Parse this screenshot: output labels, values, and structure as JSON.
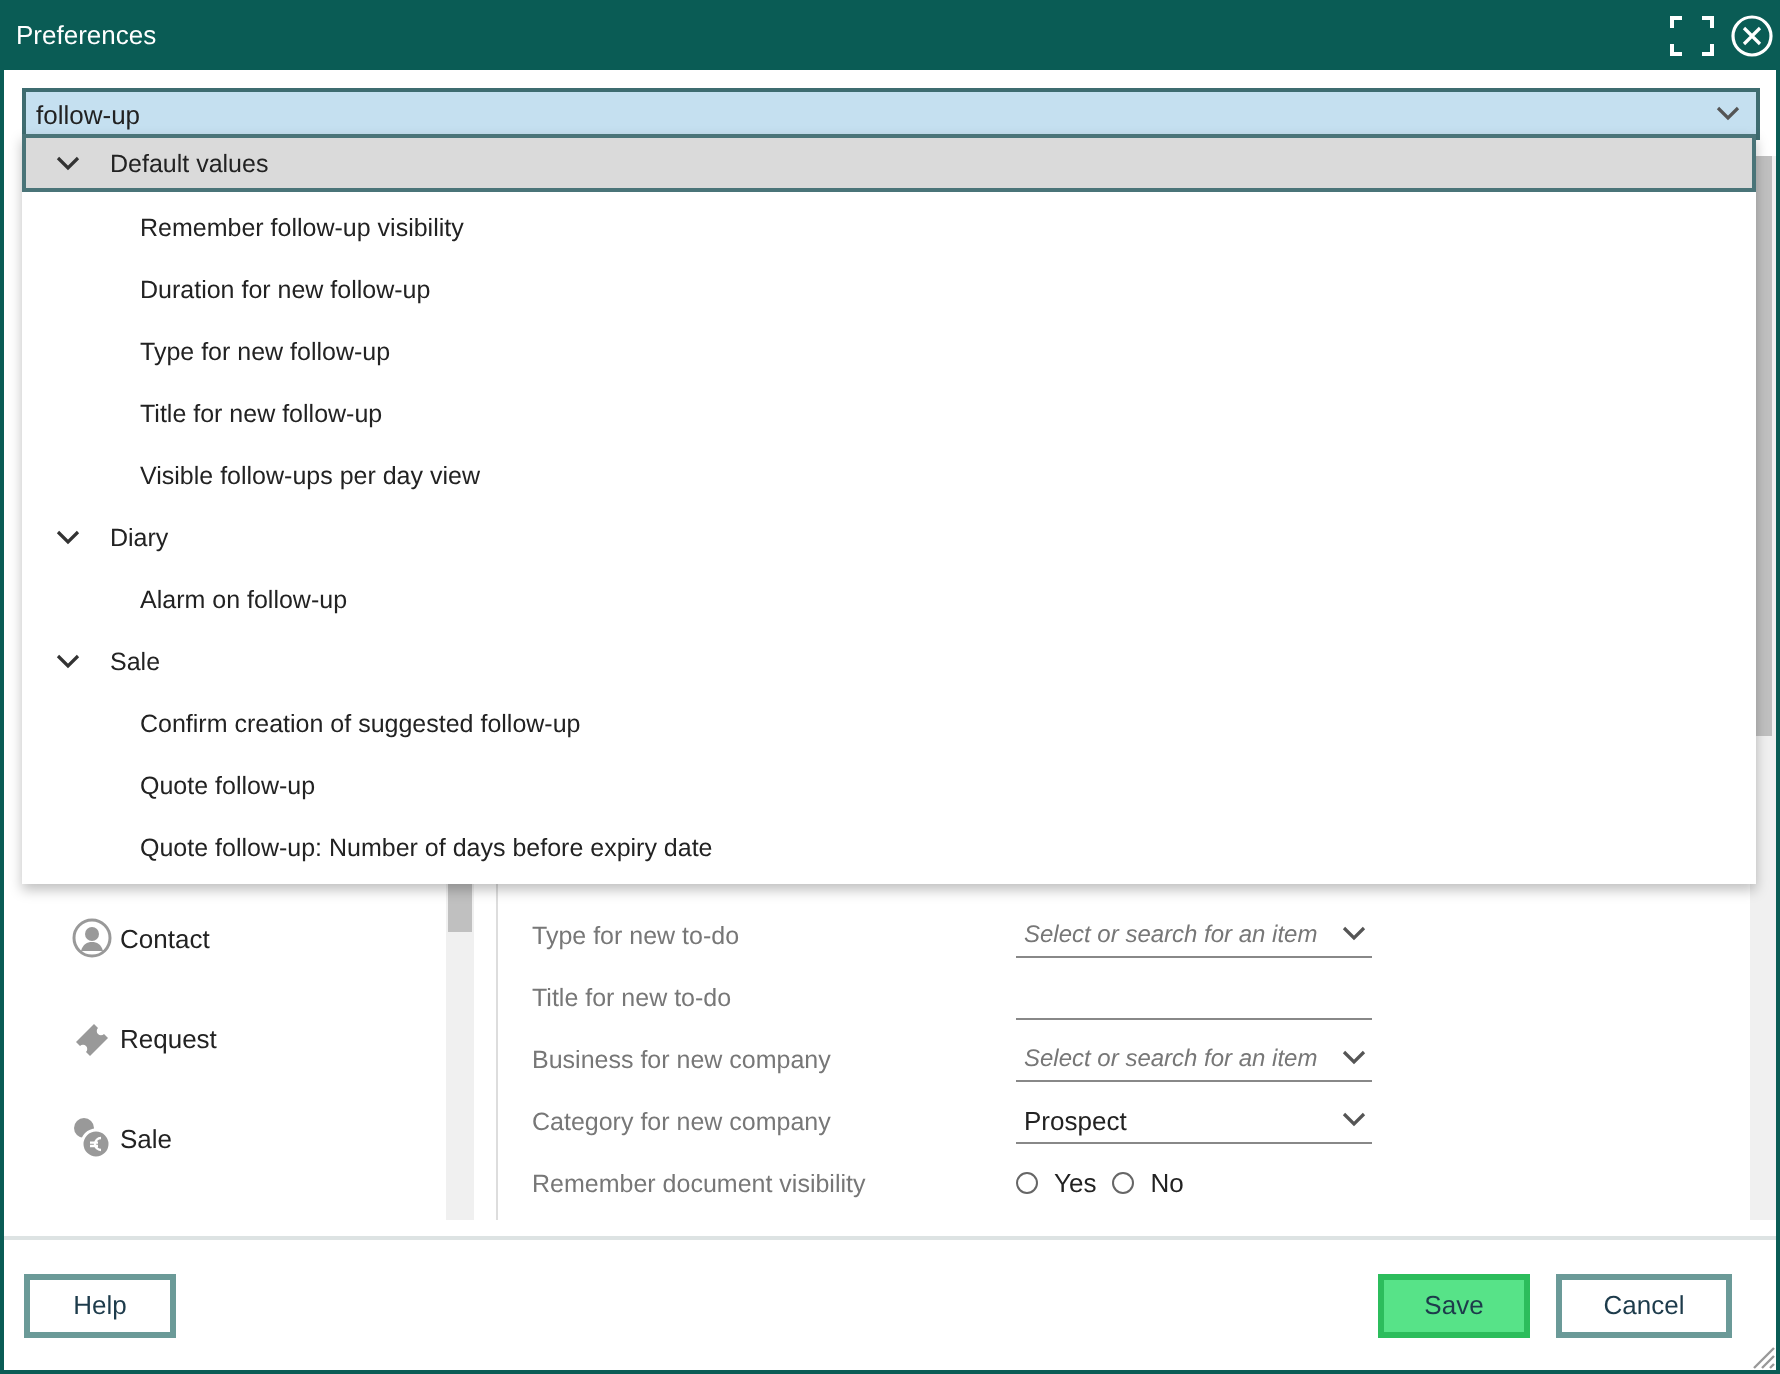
{
  "window": {
    "title": "Preferences"
  },
  "search": {
    "value": "follow-up"
  },
  "results": [
    {
      "label": "Default values",
      "expanded": true,
      "selected": true,
      "children": [
        {
          "label": "Remember follow-up visibility"
        },
        {
          "label": "Duration for new follow-up"
        },
        {
          "label": "Type for new follow-up"
        },
        {
          "label": "Title for new follow-up"
        },
        {
          "label": "Visible follow-ups per day view"
        }
      ]
    },
    {
      "label": "Diary",
      "expanded": true,
      "selected": false,
      "children": [
        {
          "label": "Alarm on follow-up"
        }
      ]
    },
    {
      "label": "Sale",
      "expanded": true,
      "selected": false,
      "children": [
        {
          "label": "Confirm creation of suggested follow-up"
        },
        {
          "label": "Quote follow-up"
        },
        {
          "label": "Quote follow-up: Number of days before expiry date"
        }
      ]
    }
  ],
  "sidebar": {
    "items": [
      {
        "label": "Contact",
        "kind": "contact"
      },
      {
        "label": "Request",
        "kind": "request"
      },
      {
        "label": "Sale",
        "kind": "sale"
      }
    ]
  },
  "settings": [
    {
      "label": "Type for new to-do",
      "kind": "select",
      "placeholder": "Select or search for an item"
    },
    {
      "label": "Title for new to-do",
      "kind": "text"
    },
    {
      "label": "Business for new company",
      "kind": "select",
      "placeholder": "Select or search for an item"
    },
    {
      "label": "Category for new company",
      "kind": "select",
      "value": "Prospect"
    },
    {
      "label": "Remember document visibility",
      "kind": "radio",
      "options": [
        {
          "label": "Yes",
          "selected": false
        },
        {
          "label": "No",
          "selected": false
        }
      ]
    }
  ],
  "buttons": [
    {
      "label": "Help",
      "kind": "plain"
    },
    {
      "label": "Save",
      "kind": "primary"
    },
    {
      "label": "Cancel",
      "kind": "plain"
    }
  ]
}
